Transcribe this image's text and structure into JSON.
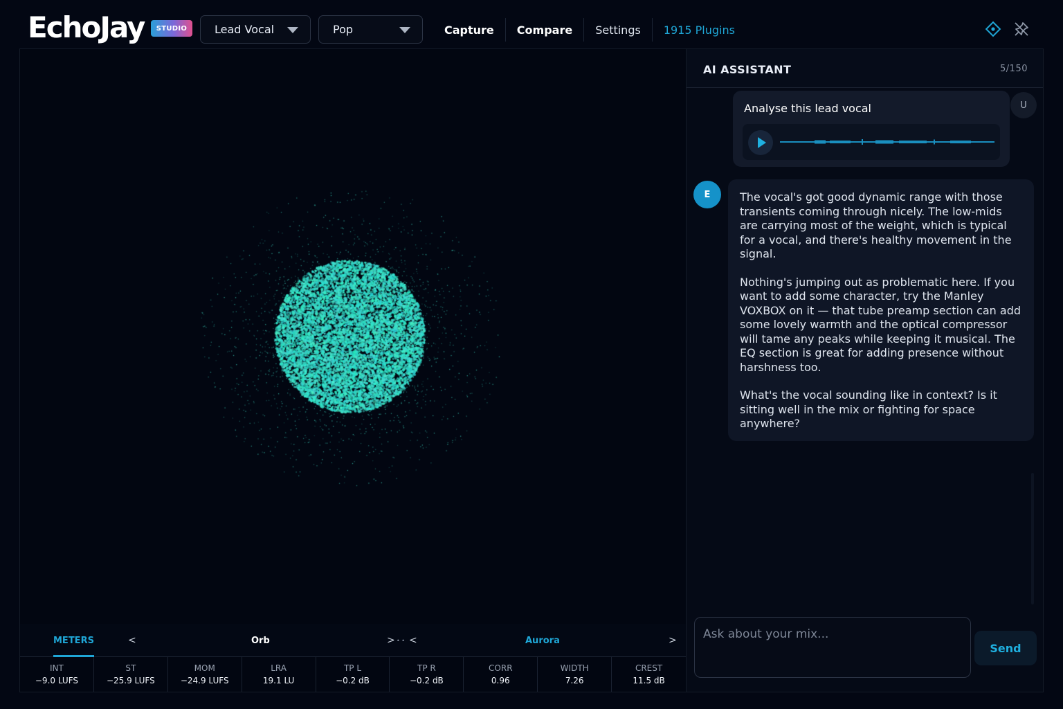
{
  "app": {
    "logo_text": "EchoJay",
    "logo_badge": "STUDIO"
  },
  "header": {
    "dropdown_track": "Lead Vocal",
    "dropdown_genre": "Pop",
    "nav": [
      {
        "label": "Capture"
      },
      {
        "label": "Compare"
      },
      {
        "label": "Settings"
      },
      {
        "label": "1915 Plugins"
      }
    ]
  },
  "visualizer": {
    "tabs": {
      "meters": "METERS",
      "prev_left": "<",
      "current": "Orb",
      "next_left": ">",
      "dots": "• •",
      "prev_right": "<",
      "alt": "Aurora",
      "next_right": ">"
    },
    "meters": [
      {
        "label": "INT",
        "value": "−9.0 LUFS"
      },
      {
        "label": "ST",
        "value": "−25.9 LUFS"
      },
      {
        "label": "MOM",
        "value": "−24.9 LUFS"
      },
      {
        "label": "LRA",
        "value": "19.1 LU"
      },
      {
        "label": "TP L",
        "value": "−0.2 dB"
      },
      {
        "label": "TP R",
        "value": "−0.2 dB"
      },
      {
        "label": "CORR",
        "value": "0.96"
      },
      {
        "label": "WIDTH",
        "value": "7.26"
      },
      {
        "label": "CREST",
        "value": "11.5 dB"
      }
    ]
  },
  "assistant": {
    "title": "AI ASSISTANT",
    "count": "5/150",
    "user_avatar": "U",
    "ai_avatar": "E",
    "user_message": "Analyse this lead vocal",
    "ai_message": [
      "The vocal's got good dynamic range with those transients coming through nicely. The low-mids are carrying most of the weight, which is typical for a vocal, and there's healthy movement in the signal.",
      "Nothing's jumping out as problematic here. If you want to add some character, try the Manley VOXBOX on it — that tube preamp section can add some lovely warmth and the optical compressor will tame any peaks while keeping it musical. The EQ section is great for adding presence without harshness too.",
      "What's the vocal sounding like in context? Is it sitting well in the mix or fighting for space anywhere?"
    ],
    "input_placeholder": "Ask about your mix...",
    "send_label": "Send"
  },
  "colors": {
    "accent": "#1fa6d6",
    "orb": "#2fd8c6",
    "background": "#030713"
  },
  "icons": {
    "top_right_1": "diamond-target-icon",
    "top_right_2": "pin-off-icon"
  }
}
